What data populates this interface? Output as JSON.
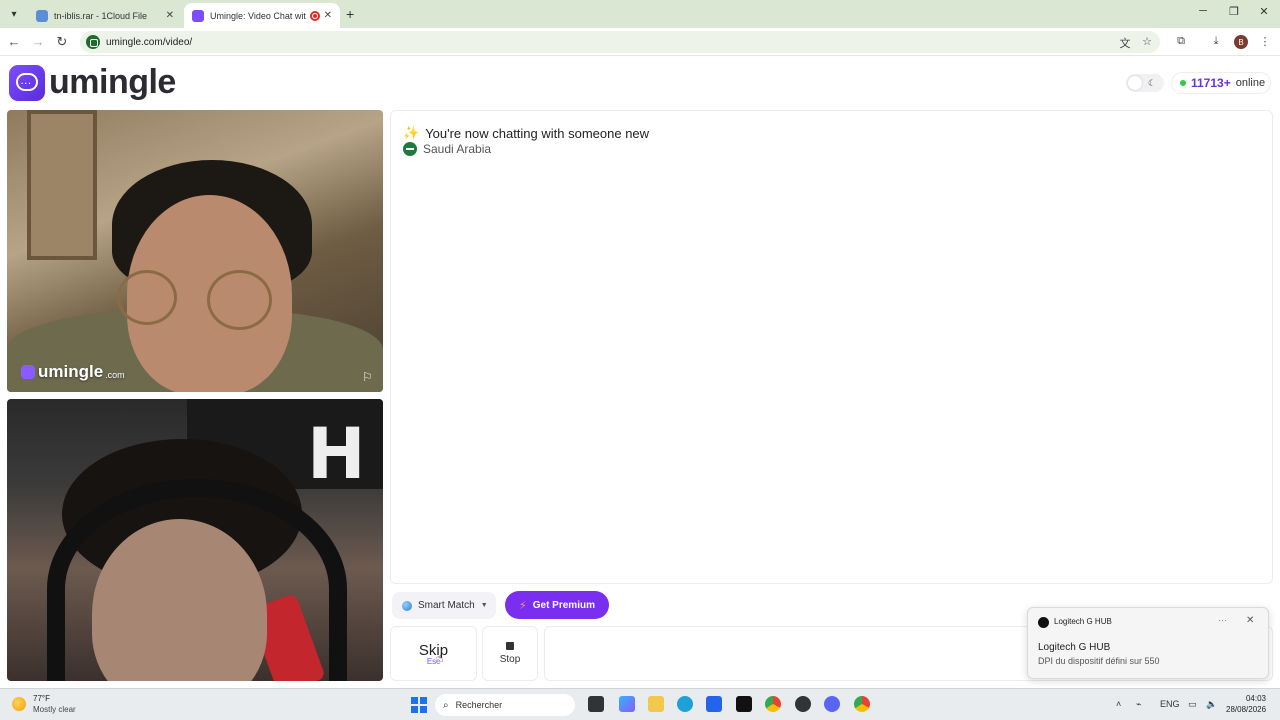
{
  "browser": {
    "tabs": [
      {
        "title": "tn-iblis.rar - 1Cloud File",
        "active": false
      },
      {
        "title": "Umingle: Video Chat with St",
        "active": true
      }
    ],
    "url": "umingle.com/video/",
    "profile_initial": "B"
  },
  "site": {
    "logo_text": "umingle",
    "online_count": "11713+",
    "online_label": "online"
  },
  "video": {
    "watermark": "umingle",
    "watermark_suffix": ".com"
  },
  "chat": {
    "status": "You're now chatting with someone new",
    "country": "Saudi Arabia"
  },
  "controls": {
    "smart_match": "Smart Match",
    "premium": "Get Premium",
    "skip": "Skip",
    "skip_hint": "Esc",
    "stop": "Stop"
  },
  "notification": {
    "app": "Logitech G HUB",
    "title": "Logitech G HUB",
    "body": "DPI du dispositif défini sur 550",
    "more": "···",
    "close": "✕"
  },
  "taskbar": {
    "weather_temp": "77°F",
    "weather_desc": "Mostly clear",
    "search_placeholder": "Rechercher",
    "language": "ENG",
    "time": "04:03",
    "date": "28/08/2026"
  },
  "colors": {
    "accent": "#7a2ff0",
    "online_dot": "#2ecc40",
    "skip_hint": "#7a55ff"
  }
}
